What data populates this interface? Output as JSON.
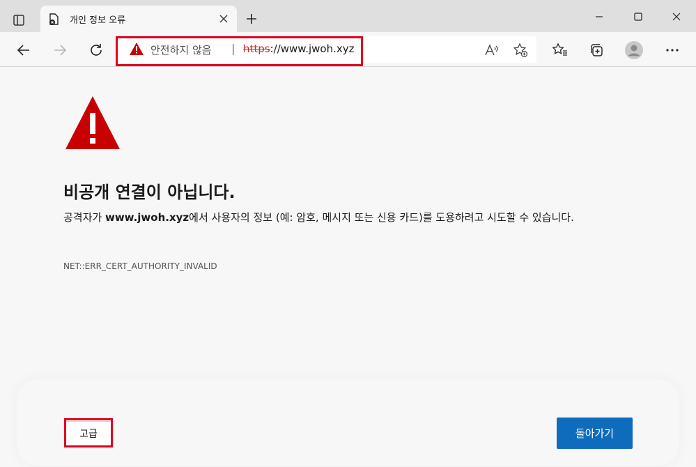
{
  "tab": {
    "title": "개인 정보 오류"
  },
  "address": {
    "warning_text": "안전하지 않음",
    "separator": "|",
    "url_scheme": "https",
    "url_rest": "://www.jwoh.xyz"
  },
  "error": {
    "heading": "비공개 연결이 아닙니다.",
    "desc_prefix": "공격자가 ",
    "desc_domain": "www.jwoh.xyz",
    "desc_suffix": "에서 사용자의 정보 (예: 암호, 메시지 또는 신용 카드)를 도용하려고 시도할 수 있습니다.",
    "code": "NET::ERR_CERT_AUTHORITY_INVALID"
  },
  "buttons": {
    "advanced": "고급",
    "back": "돌아가기"
  },
  "colors": {
    "warning_red": "#c80000",
    "highlight_red": "#e0001b",
    "primary_blue": "#0f6cbd"
  },
  "icons": [
    "tab-actions-icon",
    "not-secure-favicon-icon",
    "close-icon",
    "plus-icon",
    "minimize-icon",
    "maximize-icon",
    "window-close-icon",
    "back-arrow-icon",
    "forward-arrow-icon",
    "refresh-icon",
    "warning-triangle-icon",
    "read-aloud-icon",
    "add-favorite-icon",
    "favorites-icon",
    "collections-icon",
    "profile-avatar-icon",
    "more-icon"
  ]
}
